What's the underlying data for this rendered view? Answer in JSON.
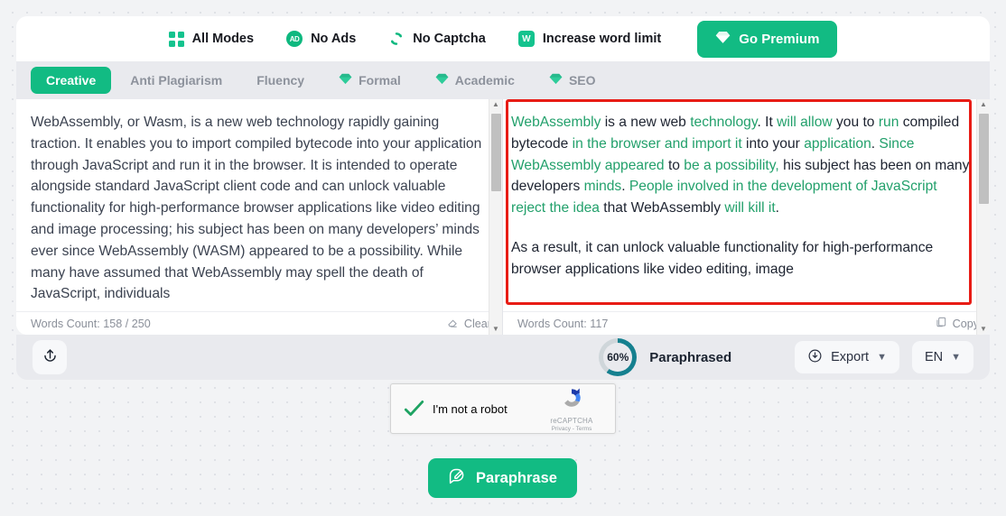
{
  "features": [
    {
      "icon": "grid-icon",
      "label": "All Modes"
    },
    {
      "icon": "no-ads-icon",
      "label": "No Ads",
      "badge": "AD"
    },
    {
      "icon": "no-captcha-icon",
      "label": "No Captcha"
    },
    {
      "icon": "word-limit-icon",
      "label": "Increase word limit",
      "badge": "W"
    }
  ],
  "premium": {
    "label": "Go Premium",
    "icon": "diamond-icon",
    "color": "#12bb83"
  },
  "tabs": [
    {
      "label": "Creative",
      "active": true,
      "premium": false
    },
    {
      "label": "Anti Plagiarism",
      "active": false,
      "premium": false
    },
    {
      "label": "Fluency",
      "active": false,
      "premium": false
    },
    {
      "label": "Formal",
      "active": false,
      "premium": true
    },
    {
      "label": "Academic",
      "active": false,
      "premium": true
    },
    {
      "label": "SEO",
      "active": false,
      "premium": true
    }
  ],
  "left_pane": {
    "text": "WebAssembly, or Wasm, is a new web technology rapidly gaining traction. It enables you to import compiled bytecode into your application through JavaScript and run it in the browser. It is intended to operate alongside standard JavaScript client code and can unlock valuable functionality for high-performance browser applications like video editing and image processing; his subject has been on many developers’ minds ever since WebAssembly (WASM) appeared to be a possibility. While many have assumed that WebAssembly may spell the death of JavaScript, individuals",
    "word_count": "Words Count: 158 / 250",
    "clear_label": "Clear",
    "clear_icon": "eraser-icon"
  },
  "right_pane": {
    "segments": [
      {
        "t": "WebAssembly",
        "h": true
      },
      {
        "t": " is a new web ",
        "h": false
      },
      {
        "t": "technology",
        "h": true
      },
      {
        "t": ". It ",
        "h": false
      },
      {
        "t": "will allow",
        "h": true
      },
      {
        "t": " you to ",
        "h": false
      },
      {
        "t": "run",
        "h": true
      },
      {
        "t": " compiled bytecode ",
        "h": false
      },
      {
        "t": "in the browser and import it",
        "h": true
      },
      {
        "t": " into your ",
        "h": false
      },
      {
        "t": "application",
        "h": true
      },
      {
        "t": ". ",
        "h": false
      },
      {
        "t": "Since WebAssembly appeared",
        "h": true
      },
      {
        "t": " to ",
        "h": false
      },
      {
        "t": "be a possibility,",
        "h": true
      },
      {
        "t": " his subject has been on many developers ",
        "h": false
      },
      {
        "t": "minds",
        "h": true
      },
      {
        "t": ". ",
        "h": false
      },
      {
        "t": "People involved in the development of JavaScript reject the idea",
        "h": true
      },
      {
        "t": " that WebAssembly ",
        "h": false
      },
      {
        "t": "will kill it",
        "h": true
      },
      {
        "t": ".",
        "h": false
      }
    ],
    "paragraph2": "As a result, it can unlock valuable functionality for high-performance browser applications like video editing, image",
    "word_count": "Words Count: 117",
    "copy_label": "Copy",
    "copy_icon": "copy-icon"
  },
  "controls": {
    "upload_icon": "upload-icon",
    "progress_value": "60%",
    "progress_percent": 60,
    "progress_color": "#15808f",
    "progress_label": "Paraphrased",
    "export_label": "Export",
    "export_icon": "download-icon",
    "language": "EN"
  },
  "recaptcha": {
    "label": "I'm not a robot",
    "brand": "reCAPTCHA",
    "terms": "Privacy - Terms",
    "checked": true
  },
  "paraphrase_button": {
    "label": "Paraphrase",
    "icon": "quill-icon"
  }
}
